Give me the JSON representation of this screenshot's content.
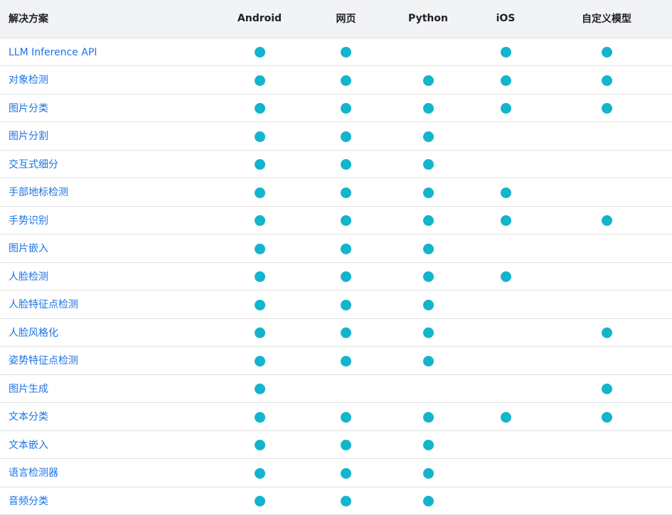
{
  "table": {
    "headers": [
      "解决方案",
      "Android",
      "网页",
      "Python",
      "iOS",
      "自定义模型"
    ],
    "rows": [
      {
        "name": "LLM Inference API",
        "support": [
          true,
          true,
          false,
          true,
          true
        ]
      },
      {
        "name": "对象检测",
        "support": [
          true,
          true,
          true,
          true,
          true
        ]
      },
      {
        "name": "图片分类",
        "support": [
          true,
          true,
          true,
          true,
          true
        ]
      },
      {
        "name": "图片分割",
        "support": [
          true,
          true,
          true,
          false,
          false
        ]
      },
      {
        "name": "交互式细分",
        "support": [
          true,
          true,
          true,
          false,
          false
        ]
      },
      {
        "name": "手部地标检测",
        "support": [
          true,
          true,
          true,
          true,
          false
        ]
      },
      {
        "name": "手势识别",
        "support": [
          true,
          true,
          true,
          true,
          true
        ]
      },
      {
        "name": "图片嵌入",
        "support": [
          true,
          true,
          true,
          false,
          false
        ]
      },
      {
        "name": "人脸检测",
        "support": [
          true,
          true,
          true,
          true,
          false
        ]
      },
      {
        "name": "人脸特征点检测",
        "support": [
          true,
          true,
          true,
          false,
          false
        ]
      },
      {
        "name": "人脸风格化",
        "support": [
          true,
          true,
          true,
          false,
          true
        ]
      },
      {
        "name": "姿势特征点检测",
        "support": [
          true,
          true,
          true,
          false,
          false
        ]
      },
      {
        "name": "图片生成",
        "support": [
          true,
          false,
          false,
          false,
          true
        ]
      },
      {
        "name": "文本分类",
        "support": [
          true,
          true,
          true,
          true,
          true
        ]
      },
      {
        "name": "文本嵌入",
        "support": [
          true,
          true,
          true,
          false,
          false
        ]
      },
      {
        "name": "语言检测器",
        "support": [
          true,
          true,
          true,
          false,
          false
        ]
      },
      {
        "name": "音频分类",
        "support": [
          true,
          true,
          true,
          false,
          false
        ]
      }
    ]
  },
  "colors": {
    "dot": "#12b5cb",
    "link": "#1a73e8",
    "header_bg": "#f1f3f4"
  },
  "icons": {
    "supported": "filled-circle-icon"
  }
}
